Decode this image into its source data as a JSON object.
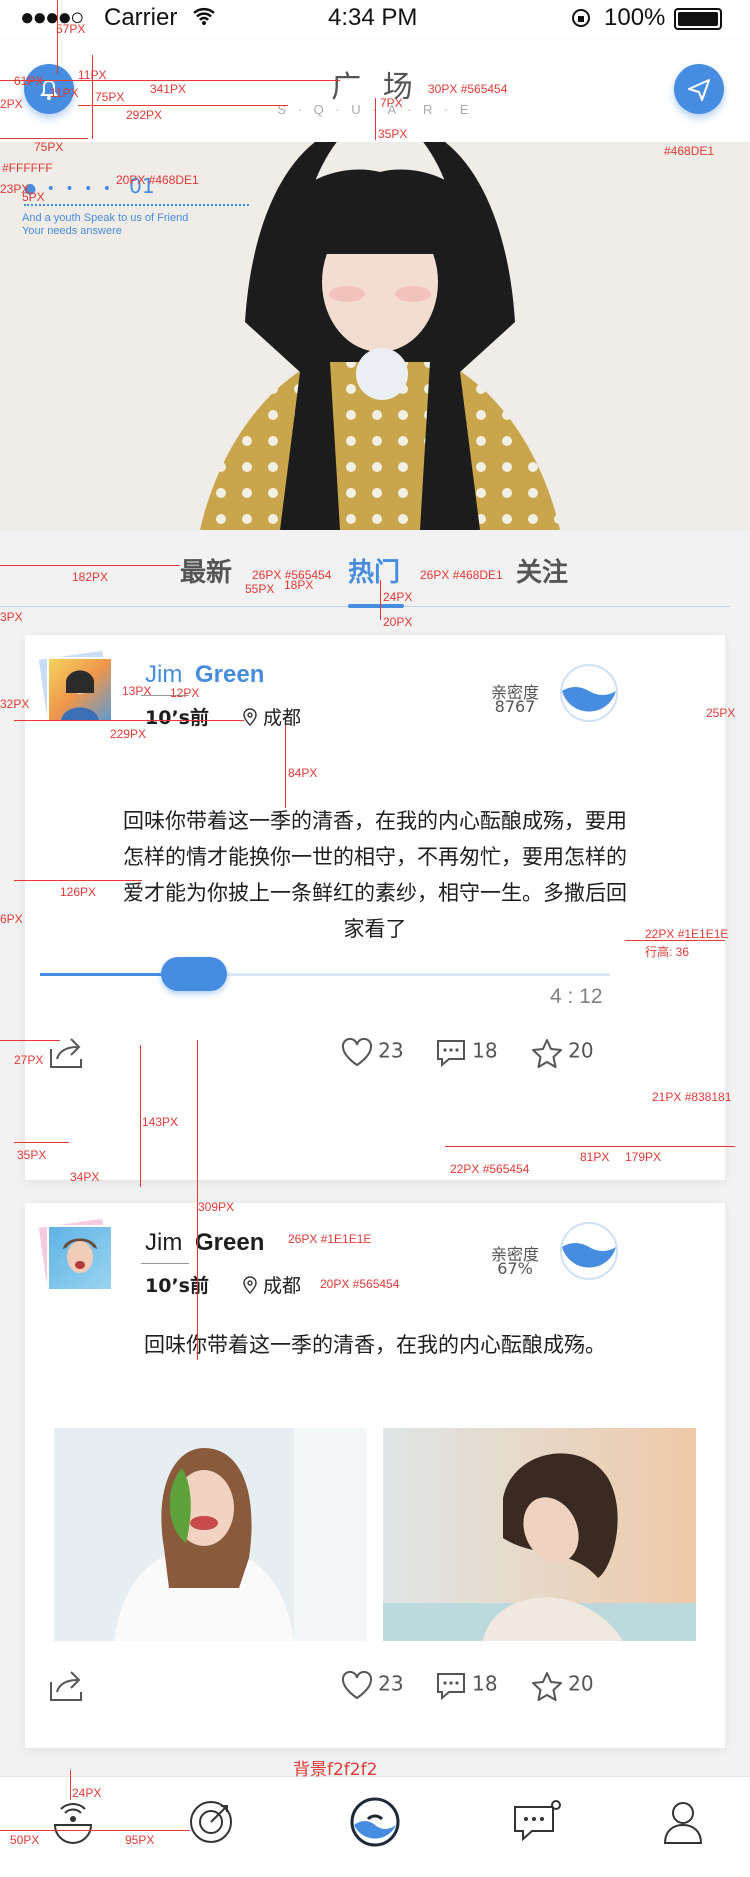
{
  "status": {
    "carrier": "Carrier",
    "time": "4:34 PM",
    "battery": "100%"
  },
  "header": {
    "title": "广 场",
    "subtitle": "S · Q · U · A · R · E"
  },
  "hero": {
    "index": "01",
    "line1": "And a youth Speak to us of Friend",
    "line2": "Your  needs answere"
  },
  "tabs": [
    {
      "label": "最新"
    },
    {
      "label": "热门"
    },
    {
      "label": "关注"
    }
  ],
  "colors": {
    "accent": "#468DE1",
    "text": "#1E1E1E",
    "muted": "#565454",
    "gray": "#838181",
    "background": "#f2f2f2"
  },
  "posts": [
    {
      "first": "Jim",
      "last": "Green",
      "time": "10’s前",
      "location": "成都",
      "intimacy_label": "亲密度",
      "intimacy_value": "8767",
      "text": "回味你带着这一季的清香，在我的内心酝酿成殇，要用怎样的情才能换你一世的相守，不再匆忙，要用怎样的爱才能为你披上一条鲜红的素纱，相守一生。多撒后回家看了",
      "audio_time": "4 : 12",
      "likes": "23",
      "comments": "18",
      "stars": "20"
    },
    {
      "first": "Jim",
      "last": "Green",
      "time": "10’s前",
      "location": "成都",
      "intimacy_label": "亲密度",
      "intimacy_value": "67%",
      "text": "回味你带着这一季的清香，在我的内心酝酿成殇。",
      "likes": "23",
      "comments": "18",
      "stars": "20"
    }
  ],
  "annotations": {
    "a57": "57PX",
    "a61": "61PX",
    "a11": "11PX",
    "a11b": "11PX",
    "a2": "2PX",
    "a341": "341PX",
    "a75a": "75PX",
    "a292": "292PX",
    "a75b": "75PX",
    "a30c": "30PX #565454",
    "a7": "7PX",
    "a35": "35PX",
    "a468": "#468DE1",
    "aFFF": "#FFFFFF",
    "a23": "23PX",
    "a5": "5PX",
    "a20blue": "20PX #468DE1",
    "a182": "182PX",
    "a26tab": "26PX #565454",
    "a55": "55PX",
    "a18": "18PX",
    "a26blue": "26PX #468DE1",
    "a24": "24PX",
    "a20": "20PX",
    "a3": "3PX",
    "a32": "32PX",
    "a13": "13PX",
    "a12": "12PX",
    "a229": "229PX",
    "a25": "25PX",
    "a84": "84PX",
    "a126": "126PX",
    "a6": "6PX",
    "a22c": "22PX #1E1E1E",
    "aLine": "行高: 36",
    "a27": "27PX",
    "a21c": "21PX #838181",
    "a143": "143PX",
    "a35b": "35PX",
    "a34": "34PX",
    "a22d": "22PX #565454",
    "a81": "81PX",
    "a179": "179PX",
    "a309": "309PX",
    "a26e": "26PX #1E1E1E",
    "a20e": "20PX #565454",
    "bg": "背景f2f2f2",
    "a24b": "24PX",
    "a50": "50PX",
    "a95": "95PX"
  }
}
